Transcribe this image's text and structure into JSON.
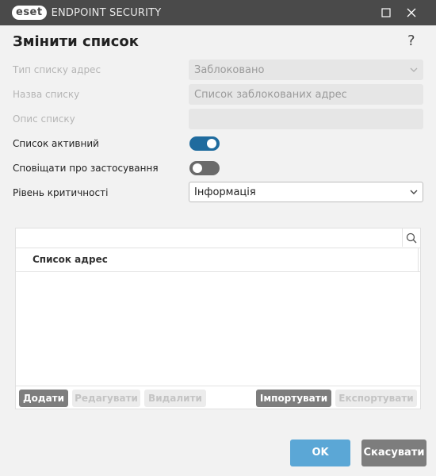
{
  "window": {
    "brand": "eset",
    "product": "ENDPOINT SECURITY"
  },
  "header": {
    "title": "Змінити список",
    "help": "?"
  },
  "form": {
    "list_type_label": "Тип списку адрес",
    "list_type_value": "Заблоковано",
    "list_name_label": "Назва списку",
    "list_name_value": "Список заблокованих адрес",
    "list_desc_label": "Опис списку",
    "list_desc_value": "",
    "active_label": "Список активний",
    "active_on": true,
    "notify_label": "Сповіщати про застосування",
    "notify_on": false,
    "severity_label": "Рівень критичності",
    "severity_value": "Інформація"
  },
  "list": {
    "search_value": "",
    "column_header": "Список адрес",
    "rows": []
  },
  "toolbar": {
    "add": "Додати",
    "edit": "Редагувати",
    "delete": "Видалити",
    "import": "Імпортувати",
    "export": "Експортувати"
  },
  "dialog": {
    "ok": "OK",
    "cancel": "Скасувати"
  },
  "colors": {
    "titlebar": "#4a4a4a",
    "toggle_on": "#1f6b9e",
    "toggle_off": "#6a6a6a",
    "ok_button": "#5ba7d6",
    "neutral_button": "#7d7d7d"
  }
}
